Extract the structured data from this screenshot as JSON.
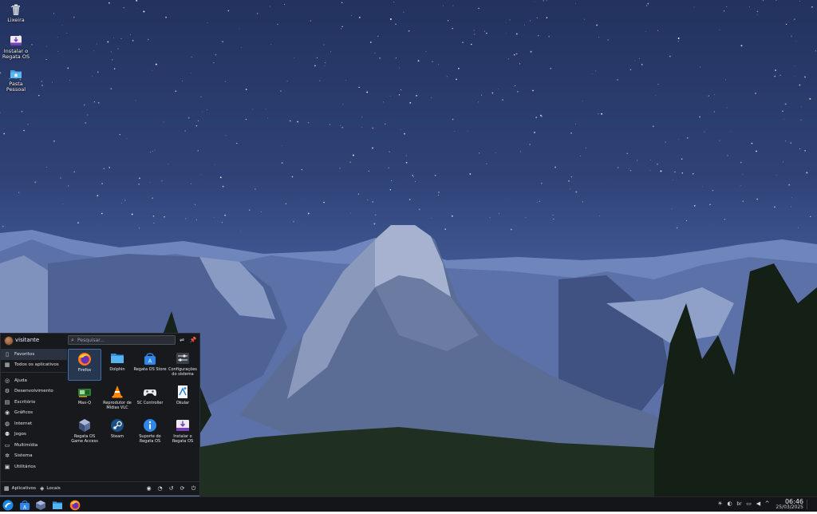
{
  "desktop": {
    "icons": [
      {
        "label": "Lixeira",
        "icon": "trash-icon"
      },
      {
        "label": "Instalar o Regata OS",
        "icon": "installer-icon"
      },
      {
        "label": "Pasta Pessoal",
        "icon": "home-folder-icon"
      }
    ]
  },
  "start_menu": {
    "user_name": "visitante",
    "search": {
      "placeholder": "Pesquisar..."
    },
    "categories": [
      {
        "label": "Favoritos",
        "icon": "bookmark-icon",
        "selected": true
      },
      {
        "label": "Todos os aplicativos",
        "icon": "grid-icon"
      },
      {
        "label": "Ajuda",
        "icon": "help-icon"
      },
      {
        "label": "Desenvolvimento",
        "icon": "code-icon"
      },
      {
        "label": "Escritório",
        "icon": "office-icon"
      },
      {
        "label": "Gráficos",
        "icon": "graphics-icon"
      },
      {
        "label": "Internet",
        "icon": "globe-icon"
      },
      {
        "label": "Jogos",
        "icon": "gamepad-icon"
      },
      {
        "label": "Multimídia",
        "icon": "monitor-icon"
      },
      {
        "label": "Sistema",
        "icon": "gear-icon"
      },
      {
        "label": "Utilitários",
        "icon": "toolbox-icon"
      }
    ],
    "apps": [
      {
        "label": "Firefox",
        "icon": "firefox-icon",
        "selected": true
      },
      {
        "label": "Dolphin",
        "icon": "folder-icon"
      },
      {
        "label": "Regata OS Store",
        "icon": "store-icon"
      },
      {
        "label": "Configurações do sistema",
        "icon": "settings-icon"
      },
      {
        "label": "Max-Q",
        "icon": "gpu-card-icon"
      },
      {
        "label": "Reprodutor de Mídias VLC",
        "icon": "vlc-cone-icon"
      },
      {
        "label": "SC Controller",
        "icon": "controller-icon"
      },
      {
        "label": "Okular",
        "icon": "document-viewer-icon"
      },
      {
        "label": "Regata OS Game Access",
        "icon": "game-access-icon"
      },
      {
        "label": "Steam",
        "icon": "steam-icon"
      },
      {
        "label": "Suporte do Regata OS",
        "icon": "info-icon"
      },
      {
        "label": "Instalar o Regata OS",
        "icon": "installer-icon"
      }
    ],
    "footer": {
      "applications_tab": "Aplicativos",
      "places_tab": "Locais"
    }
  },
  "taskbar": {
    "clock_time": "06:46",
    "clock_date": "25/03/2025",
    "tray_keyboard": "br"
  }
}
